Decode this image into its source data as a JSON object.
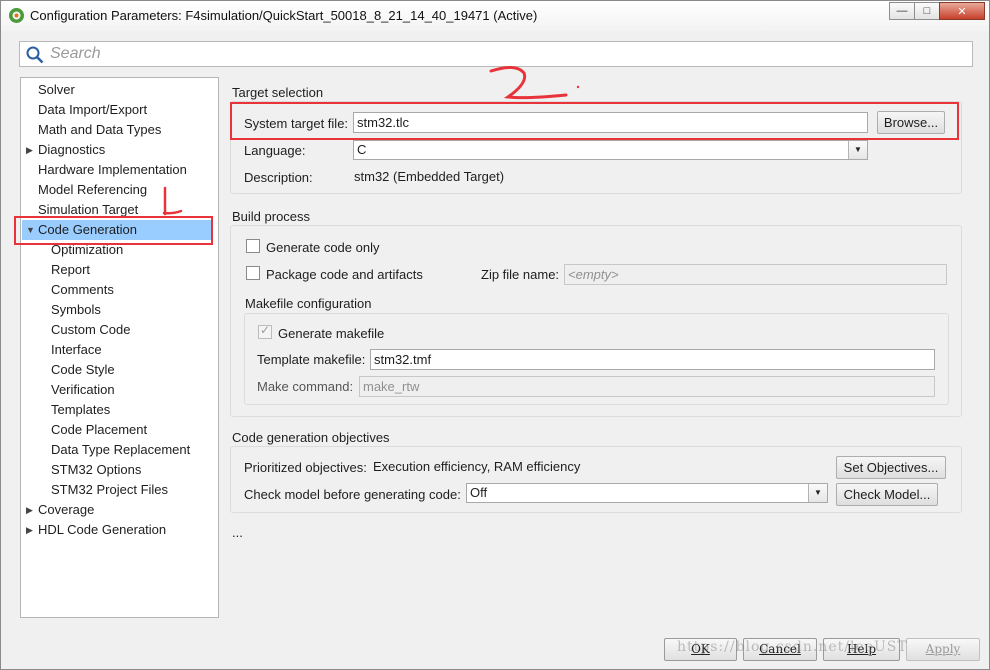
{
  "window": {
    "title": "Configuration Parameters: F4simulation/QuickStart_50018_8_21_14_40_19471 (Active)",
    "minimize": "—",
    "maximize": "□",
    "close": "✕"
  },
  "search": {
    "placeholder": "Search"
  },
  "tree": {
    "items": [
      {
        "label": "Solver"
      },
      {
        "label": "Data Import/Export"
      },
      {
        "label": "Math and Data Types"
      },
      {
        "label": "Diagnostics",
        "arrow": "▶"
      },
      {
        "label": "Hardware Implementation"
      },
      {
        "label": "Model Referencing"
      },
      {
        "label": "Simulation Target"
      },
      {
        "label": "Code Generation",
        "arrow": "▼",
        "selected": true
      },
      {
        "label": "Optimization"
      },
      {
        "label": "Report"
      },
      {
        "label": "Comments"
      },
      {
        "label": "Symbols"
      },
      {
        "label": "Custom Code"
      },
      {
        "label": "Interface"
      },
      {
        "label": "Code Style"
      },
      {
        "label": "Verification"
      },
      {
        "label": "Templates"
      },
      {
        "label": "Code Placement"
      },
      {
        "label": "Data Type Replacement"
      },
      {
        "label": "STM32 Options"
      },
      {
        "label": "STM32 Project Files"
      },
      {
        "label": "Coverage",
        "arrow": "▶"
      },
      {
        "label": "HDL Code Generation",
        "arrow": "▶"
      }
    ]
  },
  "target_selection": {
    "heading": "Target selection",
    "system_target_label": "System target file:",
    "system_target_value": "stm32.tlc",
    "browse": "Browse...",
    "language_label": "Language:",
    "language_value": "C",
    "description_label": "Description:",
    "description_value": "stm32 (Embedded Target)"
  },
  "build_process": {
    "heading": "Build process",
    "generate_code_only": "Generate code only",
    "package_code": "Package code and artifacts",
    "zip_label": "Zip file name:",
    "zip_placeholder": "<empty>",
    "makefile_heading": "Makefile configuration",
    "generate_makefile": "Generate makefile",
    "template_label": "Template makefile:",
    "template_value": "stm32.tmf",
    "make_command_label": "Make command:",
    "make_command_value": "make_rtw"
  },
  "objectives": {
    "heading": "Code generation objectives",
    "prioritized_label": "Prioritized objectives:",
    "prioritized_value": "Execution efficiency, RAM efficiency",
    "set_objectives": "Set Objectives...",
    "check_model_label": "Check model before generating code:",
    "check_model_value": "Off",
    "check_model_button": "Check Model..."
  },
  "ellipsis": "...",
  "footer": {
    "ok": "OK",
    "cancel": "Cancel",
    "help": "Help",
    "apply": "Apply"
  },
  "watermark": "https://blog.csdn.net/leeUST",
  "annotations": {
    "mark_1": "1",
    "mark_2": "2"
  },
  "colors": {
    "highlight": "#e8333a",
    "selection": "#99ccff"
  }
}
